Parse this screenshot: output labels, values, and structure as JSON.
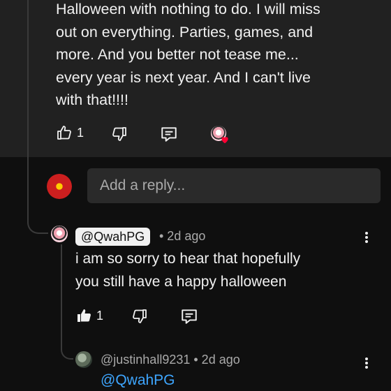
{
  "comment": {
    "lines": [
      "Halloween with nothing to do. I will miss",
      "out on everything. Parties, games, and",
      "more. And you better not tease me...",
      "every year is next year. And I can't live",
      "with that!!!!"
    ],
    "like_count": "1"
  },
  "reply_box": {
    "placeholder": "Add a reply..."
  },
  "reply1": {
    "handle": "@QwahPG",
    "time": "• 2d ago",
    "lines": [
      "i am so sorry to hear that    hopefully",
      "you still have a happy halloween"
    ],
    "like_count": "1"
  },
  "reply2": {
    "handle": "@justinhall9231",
    "time": "• 2d ago",
    "mention": "@QwahPG"
  },
  "colors": {
    "accent": "#3ea6ff",
    "heart": "#ff0033"
  }
}
